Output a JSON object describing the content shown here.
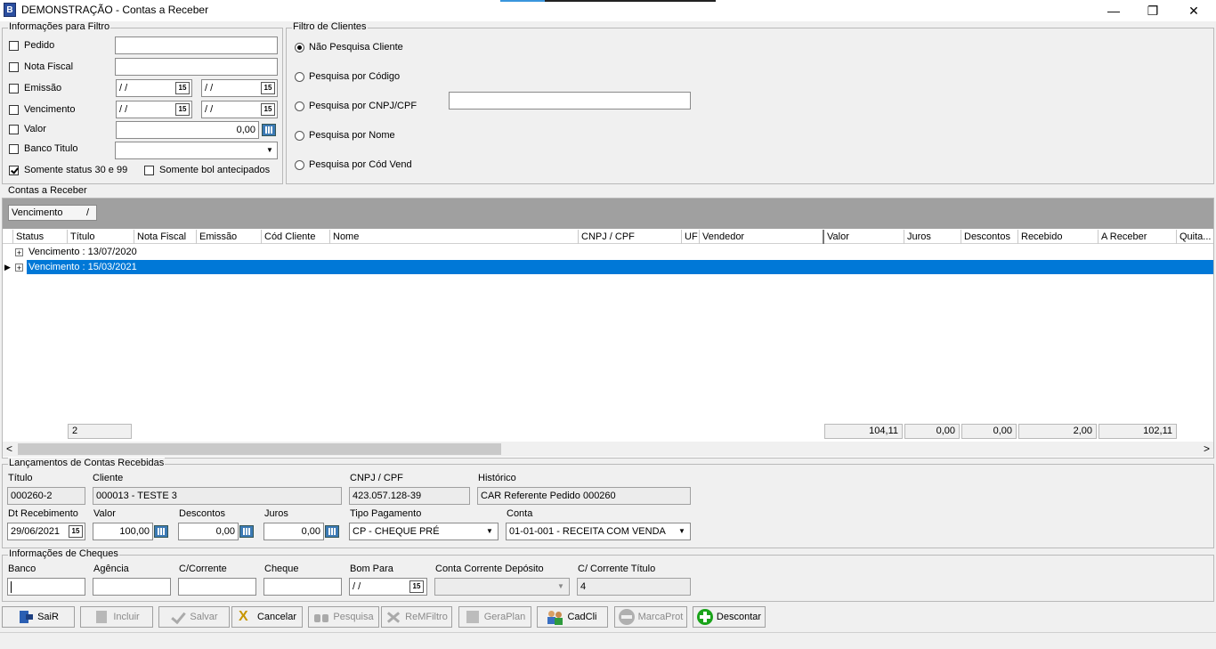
{
  "window": {
    "title": "DEMONSTRAÇÃO - Contas a Receber",
    "minimize": "—",
    "restore": "❐",
    "close": "✕"
  },
  "filtro": {
    "legend": "Informações para Filtro",
    "pedido": {
      "label": "Pedido",
      "checked": false,
      "value": ""
    },
    "nota_fiscal": {
      "label": "Nota Fiscal",
      "checked": false,
      "value": ""
    },
    "emissao": {
      "label": "Emissão",
      "checked": false,
      "de": "/ /",
      "ate": "/ /"
    },
    "vencimento": {
      "label": "Vencimento",
      "checked": false,
      "de": "/ /",
      "ate": "/ /"
    },
    "valor": {
      "label": "Valor",
      "checked": false,
      "value": "0,00"
    },
    "banco_titulo": {
      "label": "Banco Titulo",
      "checked": false,
      "value": ""
    },
    "somente_status": {
      "label": "Somente status 30 e 99",
      "checked": true
    },
    "somente_bol": {
      "label": "Somente bol antecipados",
      "checked": false
    },
    "cal_glyph": "15"
  },
  "clientes": {
    "legend": "Filtro de Clientes",
    "options": [
      "Não Pesquisa Cliente",
      "Pesquisa por Código",
      "Pesquisa por CNPJ/CPF",
      "Pesquisa por Nome",
      "Pesquisa por Cód Vend"
    ],
    "selected_index": 0,
    "cnpj_value": ""
  },
  "grid": {
    "legend": "Contas a Receber",
    "group_chip": "Vencimento",
    "group_chip_sort": "/",
    "columns": [
      "Status",
      "Título",
      "Nota Fiscal",
      "Emissão",
      "Cód Cliente",
      "Nome",
      "CNPJ / CPF",
      "UF",
      "Vendedor",
      "Valor",
      "Juros",
      "Descontos",
      "Recebido",
      "A Receber",
      "Quita..."
    ],
    "groups": [
      "Vencimento : 13/07/2020",
      "Vencimento : 15/03/2021"
    ],
    "selected_group": 1,
    "footer": {
      "count": "2",
      "valor": "104,11",
      "juros": "0,00",
      "descontos": "0,00",
      "recebido": "2,00",
      "a_receber": "102,11"
    },
    "scroll_left": "<",
    "scroll_right": ">"
  },
  "lancamentos": {
    "legend": "Lançamentos de Contas Recebidas",
    "titulo_label": "Título",
    "titulo": "000260-2",
    "cliente_label": "Cliente",
    "cliente": "000013 - TESTE 3",
    "cnpj_label": "CNPJ / CPF",
    "cnpj": "423.057.128-39",
    "historico_label": "Histórico",
    "historico": "CAR Referente Pedido 000260",
    "dt_label": "Dt Recebimento",
    "dt": "29/06/2021",
    "valor_label": "Valor",
    "valor": "100,00",
    "descontos_label": "Descontos",
    "descontos": "0,00",
    "juros_label": "Juros",
    "juros": "0,00",
    "tipo_label": "Tipo Pagamento",
    "tipo": "CP - CHEQUE PRÉ",
    "conta_label": "Conta",
    "conta": "01-01-001 - RECEITA COM VENDA"
  },
  "cheques": {
    "legend": "Informações de Cheques",
    "banco_label": "Banco",
    "agencia_label": "Agência",
    "ccorrente_label": "C/Corrente",
    "cheque_label": "Cheque",
    "bompara_label": "Bom Para",
    "bompara": "/ /",
    "contadep_label": "Conta Corrente Depósito",
    "cctitulo_label": "C/ Corrente Título",
    "cctitulo": "4"
  },
  "toolbar": {
    "sair": "SaiR",
    "incluir": "Incluir",
    "salvar": "Salvar",
    "cancelar": "Cancelar",
    "pesquisa": "Pesquisa",
    "remfiltro": "ReMFiltro",
    "geraplan": "GeraPlan",
    "cadcli": "CadCli",
    "marcaprot": "MarcaProt",
    "descontar": "Descontar"
  },
  "colors": {
    "selection": "#0078d7",
    "group_bar": "#a0a0a0",
    "accent_green": "#1aa31a"
  }
}
